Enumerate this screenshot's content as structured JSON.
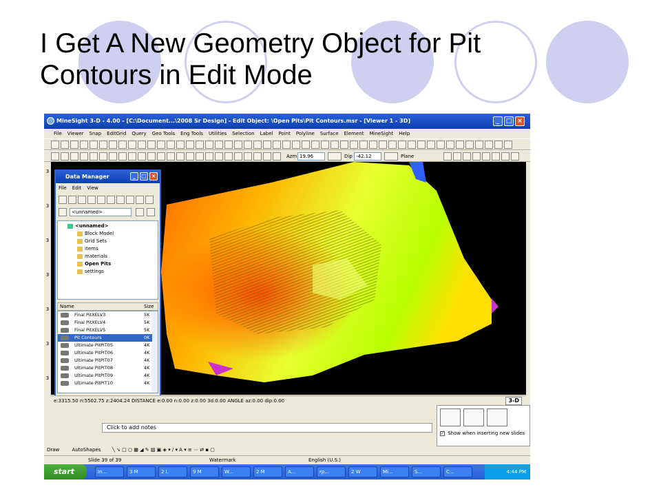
{
  "slide": {
    "title": "I Get A New Geometry Object for Pit Contours in Edit Mode"
  },
  "app": {
    "window_title": "MineSight 3-D  - 4.00 - [C:\\Document...\\2008 Sr Design] - Edit Object: \\Open Pits\\Pit Contours.msr  - [Viewer 1 - 3D]",
    "menu": [
      "File",
      "Viewer",
      "Snap",
      "EditGrid",
      "Query",
      "Geo Tools",
      "Eng Tools",
      "Utilities",
      "Selection",
      "Label",
      "Point",
      "Polyline",
      "Surface",
      "Element",
      "MineSight",
      "Help"
    ],
    "azm_label": "Azm",
    "azm_value": "19.96",
    "dip_label": "Dip",
    "dip_value": "-42.12",
    "plane_label": "Plane",
    "status_text": "e:3315.50  n:5502.75  z:2404.24    DISTANCE  e:0.00  n:0.00  z:0.00  3d:0.00    ANGLE  az:0.00  dip:0.00",
    "logo_text": "3-D"
  },
  "data_manager": {
    "title": "Data Manager",
    "menu": [
      "File",
      "Edit",
      "View"
    ],
    "path_value": "<unnamed>",
    "tree": [
      {
        "label": "<unnamed>",
        "bold": true
      },
      {
        "label": "Block Model",
        "bold": false
      },
      {
        "label": "Grid Sets",
        "bold": false
      },
      {
        "label": "items",
        "bold": false
      },
      {
        "label": "materials",
        "bold": false
      },
      {
        "label": "Open Pits",
        "bold": true
      },
      {
        "label": "settings",
        "bold": false
      }
    ],
    "columns": {
      "name": "Name",
      "size": "Size"
    },
    "rows": [
      {
        "name": "Final PitXELV3",
        "size": "5K",
        "selected": false
      },
      {
        "name": "Final PitXELV4",
        "size": "5K",
        "selected": false
      },
      {
        "name": "Final PitXELV5",
        "size": "5K",
        "selected": false
      },
      {
        "name": "Pit Contours",
        "size": "0K",
        "selected": true
      },
      {
        "name": "Ultimate PitPIT05",
        "size": "4K",
        "selected": false
      },
      {
        "name": "Ultimate PitPIT06",
        "size": "4K",
        "selected": false
      },
      {
        "name": "Ultimate PitPIT07",
        "size": "4K",
        "selected": false
      },
      {
        "name": "Ultimate PitPIT08",
        "size": "4K",
        "selected": false
      },
      {
        "name": "Ultimate PitPIT09",
        "size": "4K",
        "selected": false
      },
      {
        "name": "Ultimate PitPIT10",
        "size": "4K",
        "selected": false
      }
    ]
  },
  "powerpoint": {
    "notes_placeholder": "Click to add notes",
    "show_when_inserting": "Show when inserting new slides",
    "draw_label": "Draw",
    "autoshapes_label": "AutoShapes",
    "slide_counter": "Slide 39 of 39",
    "design_name": "Watermark",
    "language": "English (U.S.)"
  },
  "taskbar": {
    "start_label": "start",
    "tasks": [
      "In...",
      "3 M",
      "2 I.",
      "9 M",
      "W...",
      "2 M",
      "A...",
      "rp...",
      "2 W",
      "Mi...",
      "S...",
      "C..."
    ],
    "clock": "4:44 PM"
  },
  "colors": {
    "circle": "#cfd0f0",
    "xp_blue": "#245edb",
    "selection": "#316ac5"
  }
}
